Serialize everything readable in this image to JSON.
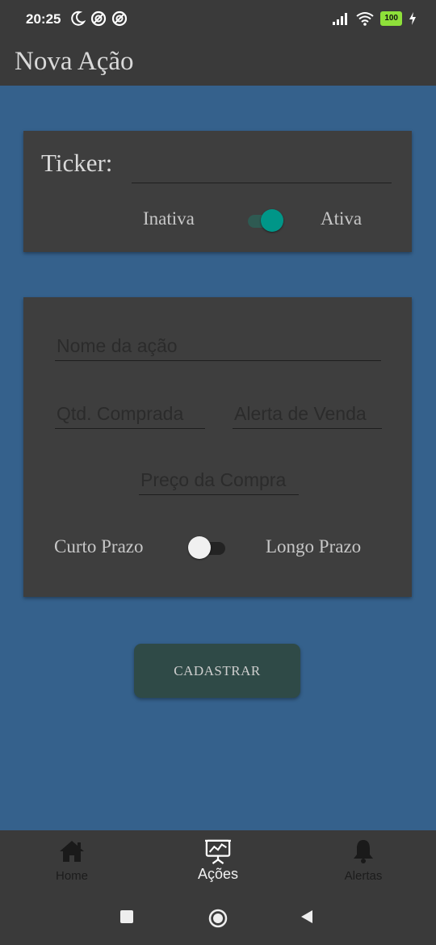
{
  "status_bar": {
    "time": "20:25",
    "left_icons": [
      "moon-icon",
      "dnd-icon",
      "dnd-icon"
    ],
    "right_icons": [
      "signal-icon",
      "wifi-icon",
      "battery-icon",
      "charging-icon"
    ],
    "battery": "100"
  },
  "app_bar": {
    "title": "Nova Ação"
  },
  "ticker_card": {
    "label": "Ticker:",
    "input_value": "",
    "switch_off_label": "Inativa",
    "switch_on_label": "Ativa",
    "switch_state": "on"
  },
  "form_card": {
    "nome_placeholder": "Nome da ação",
    "qtd_placeholder": "Qtd. Comprada",
    "alerta_placeholder": "Alerta de Venda",
    "preco_placeholder": "Preço da Compra",
    "switch_left_label": "Curto Prazo",
    "switch_right_label": "Longo Prazo",
    "switch_state": "off"
  },
  "submit_button": {
    "label": "CADASTRAR"
  },
  "bottom_nav": {
    "items": [
      {
        "label": "Home",
        "icon": "home-icon",
        "active": false
      },
      {
        "label": "Ações",
        "icon": "presentation-chart-icon",
        "active": true
      },
      {
        "label": "Alertas",
        "icon": "bell-icon",
        "active": false
      }
    ]
  },
  "system_nav": {
    "icons": [
      "square-icon",
      "circle-icon",
      "back-triangle-icon"
    ]
  },
  "colors": {
    "background": "#35618c",
    "bars": "#3a3a3a",
    "card": "#3e3e3e",
    "accent": "#009688",
    "button": "#2f4a47"
  }
}
